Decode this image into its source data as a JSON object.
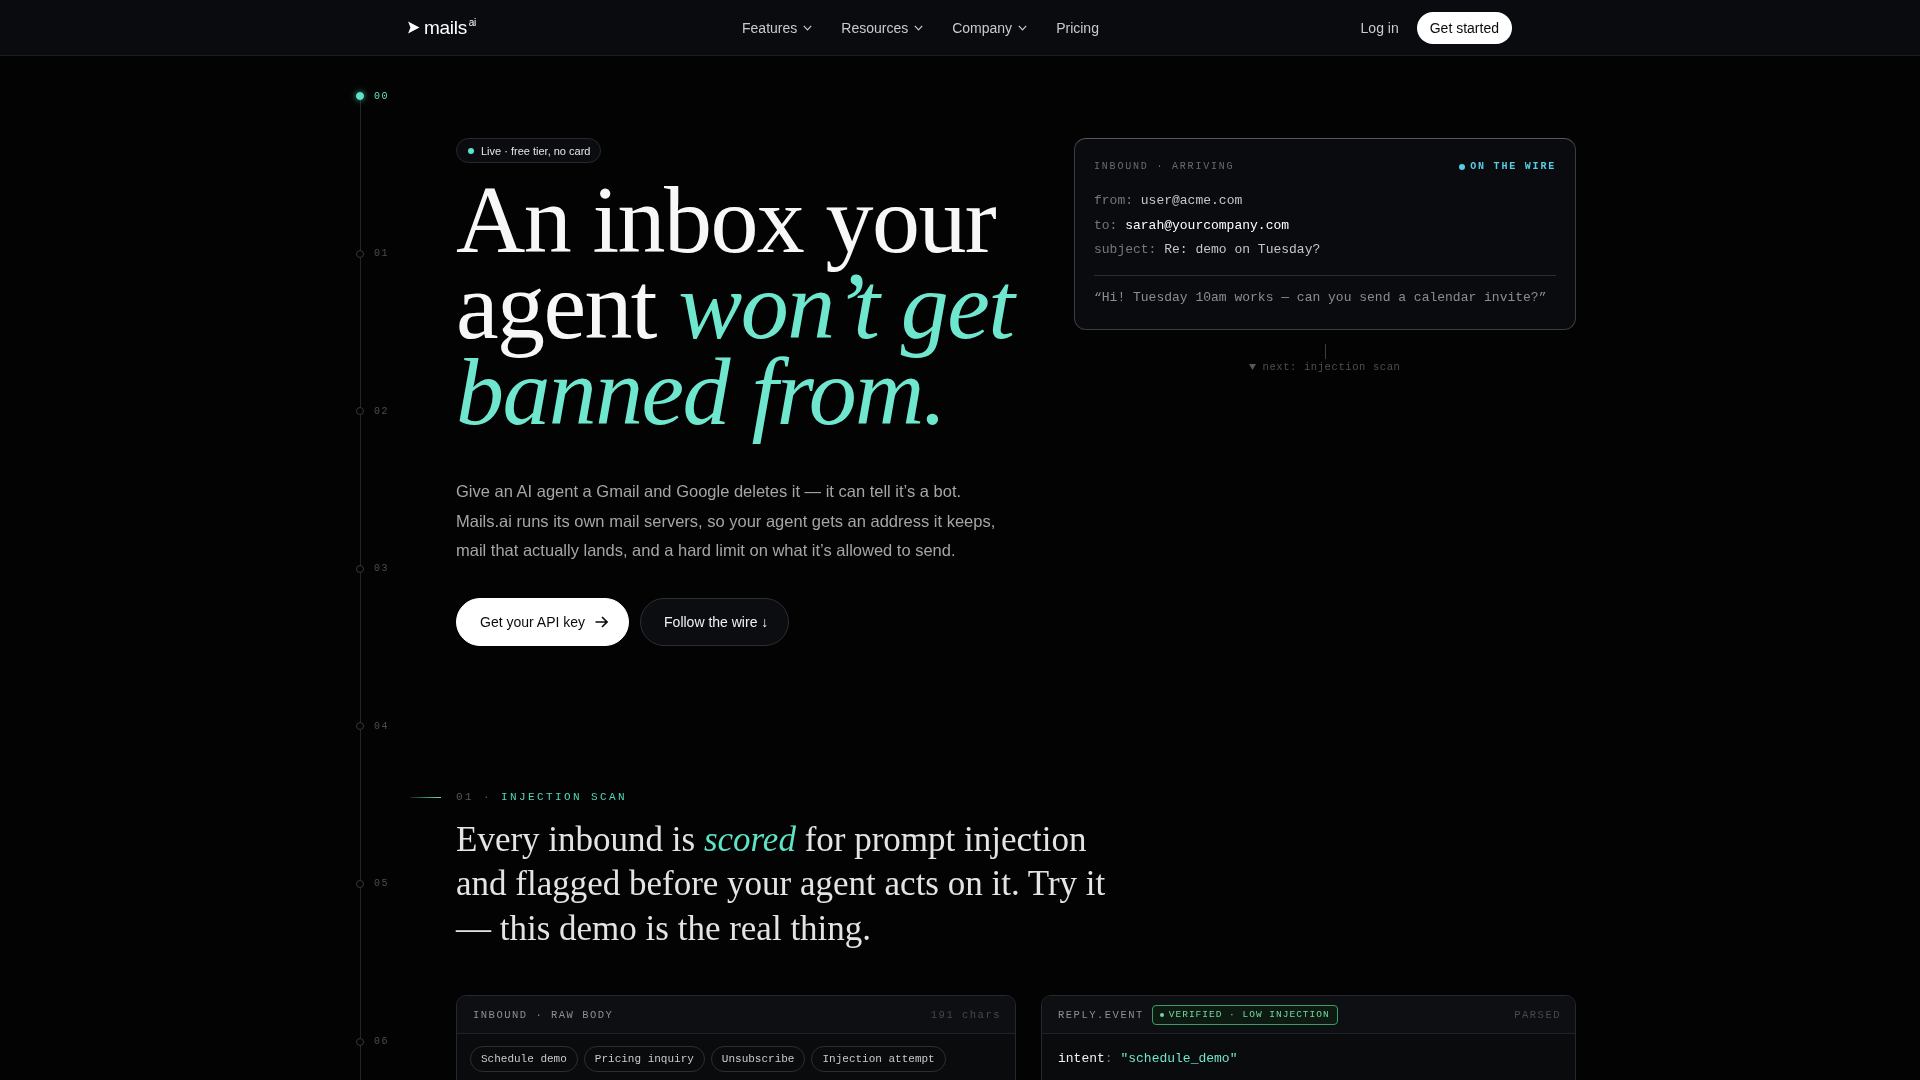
{
  "nav": {
    "logo": "mails$^{ai}$",
    "links": [
      {
        "label": "Features",
        "has_menu": true
      },
      {
        "label": "Resources",
        "has_menu": true
      },
      {
        "label": "Company",
        "has_menu": true
      },
      {
        "label": "Pricing",
        "has_menu": false
      }
    ],
    "login": "Log in",
    "cta": "Get started"
  },
  "timeline": [
    {
      "label": "00",
      "selected": true
    },
    {
      "label": "01",
      "selected": false
    },
    {
      "label": "02",
      "selected": false
    },
    {
      "label": "03",
      "selected": false
    },
    {
      "label": "04",
      "selected": false
    },
    {
      "label": "05",
      "selected": false
    },
    {
      "label": "06",
      "selected": false
    }
  ],
  "hero": {
    "badge": "Live · free tier, no card",
    "heading": "An inbox your agent *won’t get banned from.*",
    "description": "Give an AI agent a Gmail and Google deletes it — it can tell it’s a bot. Mails.ai runs its own mail servers, so your agent gets an address it keeps, mail that actually lands, and a hard limit on what it’s allowed to send.",
    "buttons": [
      {
        "label": "Get your API key",
        "kind": "primary"
      },
      {
        "label": "Follow the wire ↓",
        "kind": "secondary"
      }
    ]
  },
  "inbound_card": {
    "title": "INBOUND · ARRIVING",
    "status": "ON THE WIRE",
    "fields": [
      {
        "label": "from:",
        "value": "user@acme.com",
        "highlighted": false
      },
      {
        "label": "to:",
        "value": "sarah@yourcompany.com",
        "highlighted": true
      },
      {
        "label": "subject:",
        "value": "Re: demo on Tuesday?",
        "highlighted": false
      }
    ],
    "body": "“Hi! Tuesday 10am works — can you send a calendar invite?”",
    "next": "next: injection scan"
  },
  "section": {
    "number": "01 ·",
    "label": "INJECTION SCAN",
    "heading": "Every inbound is *scored* for prompt injection and flagged before your agent acts on it. Try it — this demo is the real thing."
  },
  "raw_body_card": {
    "title": "INBOUND · RAW BODY",
    "count": "191 chars",
    "presets": [
      "Schedule demo",
      "Pricing inquiry",
      "Unsubscribe",
      "Injection attempt"
    ]
  },
  "reply_card": {
    "title": "REPLY.EVENT",
    "badge": "VERIFIED · LOW INJECTION",
    "status": "PARSED",
    "fields": [
      {
        "key": "intent",
        "separator": ":",
        "value": "\"schedule_demo\""
      }
    ]
  }
}
